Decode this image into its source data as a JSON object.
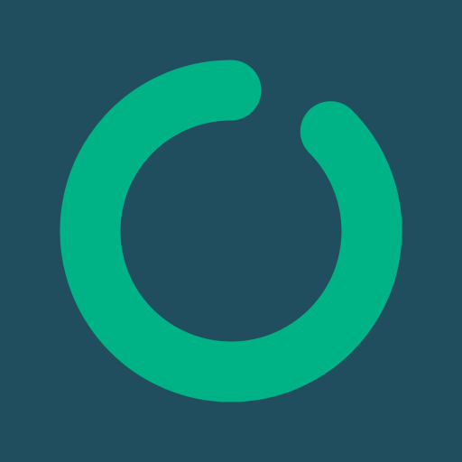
{
  "screen": {
    "background_color": "#214e5f"
  },
  "spinner": {
    "icon": "loading-ring-icon",
    "color": "#00b386",
    "progress_fraction": 0.875
  }
}
